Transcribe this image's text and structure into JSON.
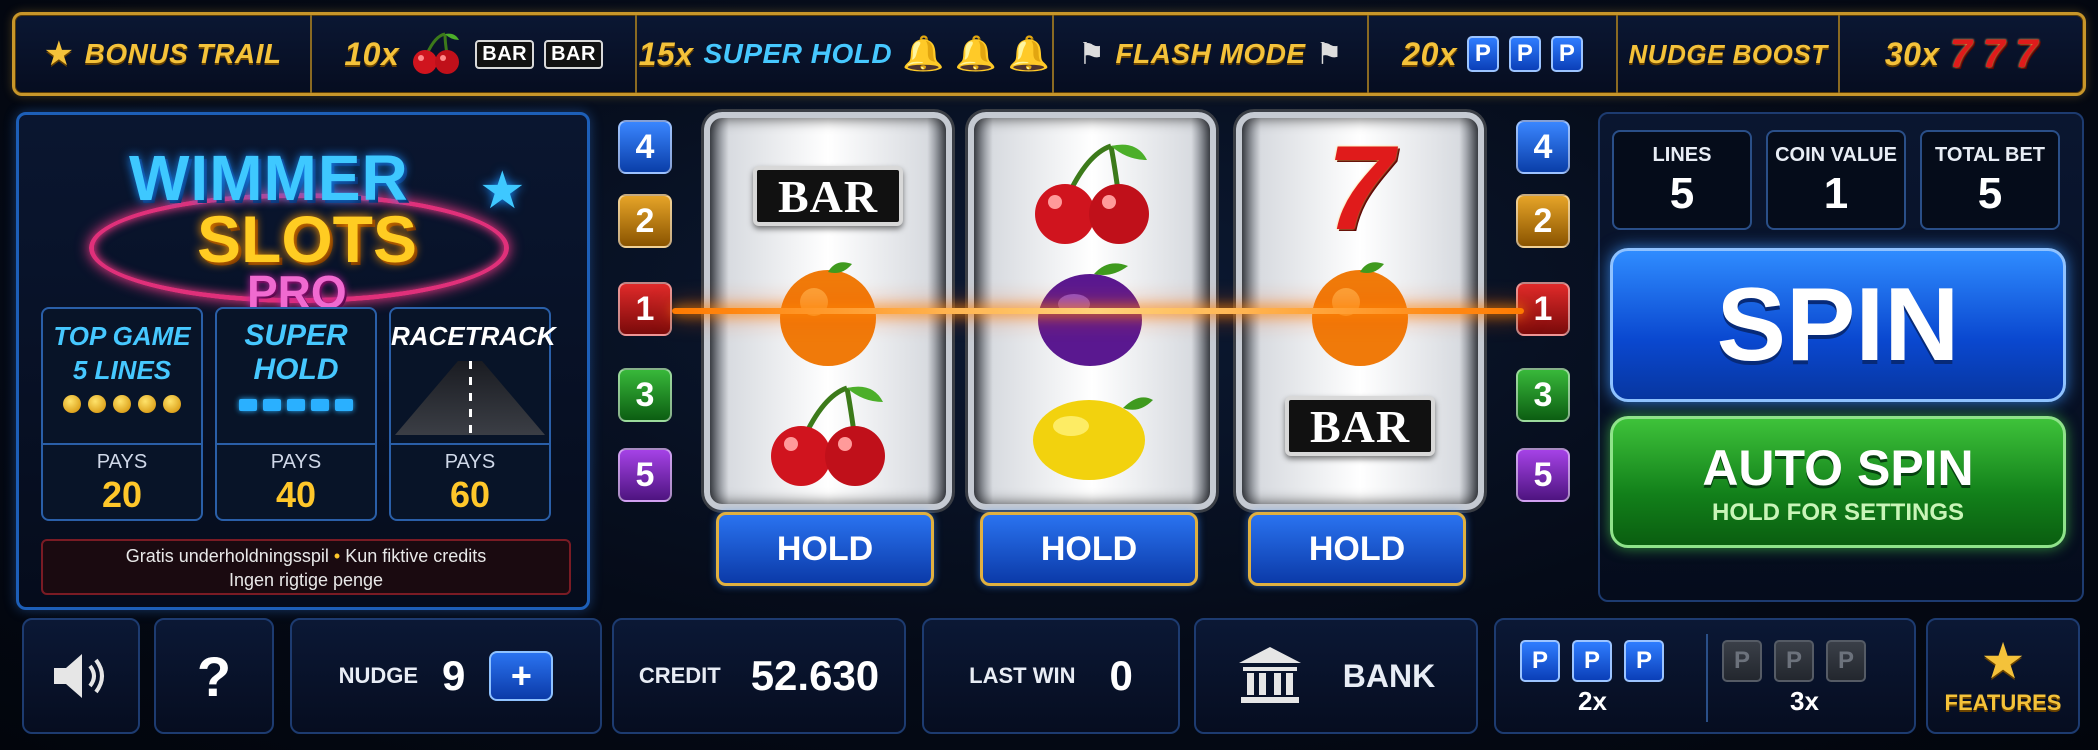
{
  "top_bar": {
    "bonus_trail": "BONUS TRAIL",
    "cherries_mult": "10x",
    "bar_chip": "BAR",
    "super_hold_mult": "15x",
    "super_hold": "SUPER HOLD",
    "flash_mode": "FLASH MODE",
    "p_mult": "20x",
    "p_letter": "P",
    "nudge_boost": "NUDGE BOOST",
    "sevens_mult": "30x",
    "seven": "7"
  },
  "logo": {
    "line1": "WIMMER",
    "line2": "SLOTS",
    "line3": "PRO"
  },
  "games": [
    {
      "title_1": "TOP GAME",
      "title_2": "5 LINES",
      "pays_label": "PAYS",
      "pays": "20"
    },
    {
      "title_1": "SUPER",
      "title_2": "HOLD",
      "pays_label": "PAYS",
      "pays": "40"
    },
    {
      "title_1": "RACETRACK",
      "title_2": "",
      "pays_label": "PAYS",
      "pays": "60"
    }
  ],
  "disclaimer": {
    "part1": "Gratis underholdningsspil",
    "bullet": "•",
    "part2": "Kun fiktive credits",
    "line2": "Ingen rigtige penge"
  },
  "line_numbers": [
    "4",
    "2",
    "1",
    "3",
    "5"
  ],
  "reels": {
    "bar_label": "BAR",
    "seven": "7",
    "hold_label": "HOLD"
  },
  "stats": {
    "lines_label": "LINES",
    "lines": "5",
    "coin_label": "COIN VALUE",
    "coin": "1",
    "bet_label": "TOTAL BET",
    "bet": "5"
  },
  "buttons": {
    "spin": "SPIN",
    "auto_spin": "AUTO SPIN",
    "auto_sub": "HOLD FOR SETTINGS",
    "help": "?",
    "plus": "+"
  },
  "bottom": {
    "nudge_label": "NUDGE",
    "nudge": "9",
    "credit_label": "CREDIT",
    "credit": "52.630",
    "last_win_label": "LAST WIN",
    "last_win": "0",
    "bank_label": "BANK",
    "p_letter": "P",
    "mult_2x": "2x",
    "mult_3x": "3x",
    "features_label": "FEATURES"
  },
  "colors": {
    "gold": "#f4c23a",
    "spin_blue": "#0a48d0",
    "auto_green": "#12801a",
    "win_line": "#ff8c00"
  }
}
